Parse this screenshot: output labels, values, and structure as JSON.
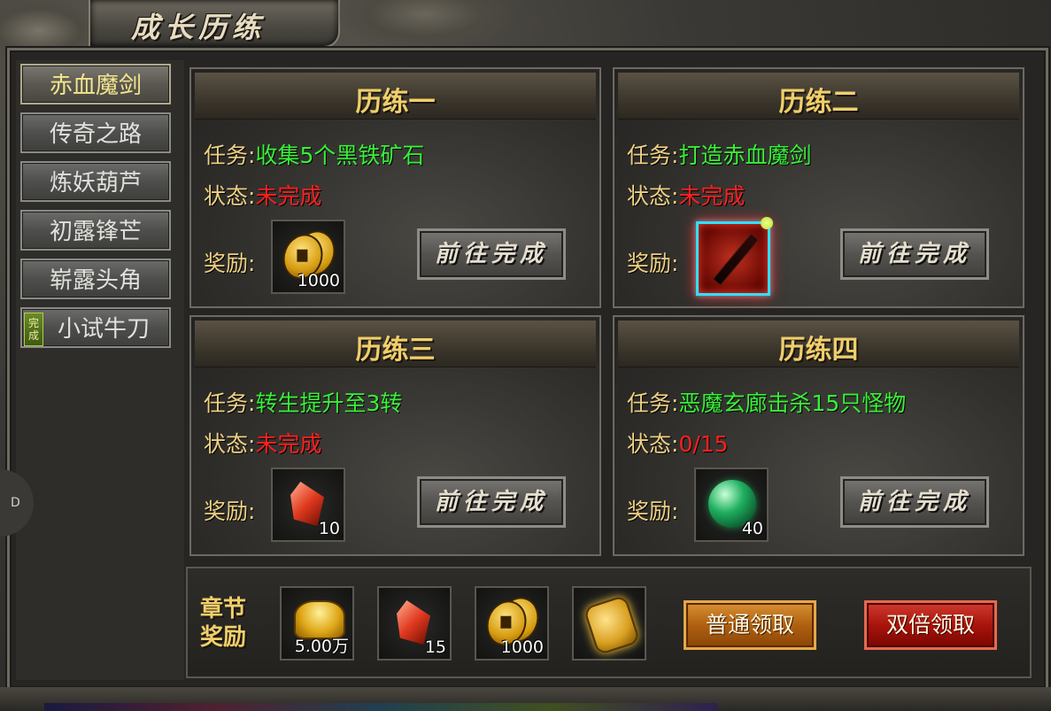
{
  "window": {
    "title": "成长历练"
  },
  "sidebar": {
    "tabs": [
      {
        "label": "赤血魔剑",
        "active": true
      },
      {
        "label": "传奇之路",
        "active": false
      },
      {
        "label": "炼妖葫芦",
        "active": false
      },
      {
        "label": "初露锋芒",
        "active": false
      },
      {
        "label": "崭露头角",
        "active": false
      },
      {
        "label": "小试牛刀",
        "active": false,
        "badge": "完成"
      }
    ]
  },
  "labels": {
    "task": "任务:",
    "status": "状态:",
    "reward": "奖励:"
  },
  "cards": [
    {
      "title": "历练一",
      "task": "收集5个黑铁矿石",
      "status": "未完成",
      "reward_icon": "gold-coin-icon",
      "reward_count": "1000",
      "button": "前往完成"
    },
    {
      "title": "历练二",
      "task": "打造赤血魔剑",
      "status": "未完成",
      "reward_icon": "crimson-sword-icon",
      "reward_count": "",
      "button": "前往完成"
    },
    {
      "title": "历练三",
      "task": "转生提升至3转",
      "status": "未完成",
      "reward_icon": "red-crystal-icon",
      "reward_count": "10",
      "button": "前往完成"
    },
    {
      "title": "历练四",
      "task": "恶魔玄廊击杀15只怪物",
      "status": "0/15",
      "reward_icon": "green-orb-icon",
      "reward_count": "40",
      "button": "前往完成"
    }
  ],
  "chapter": {
    "label_line1": "章节",
    "label_line2": "奖励",
    "rewards": [
      {
        "icon": "gold-ingot-icon",
        "count": "5.00万"
      },
      {
        "icon": "red-crystal-icon",
        "count": "15"
      },
      {
        "icon": "gold-coin-icon",
        "count": "1000"
      },
      {
        "icon": "gold-token-icon",
        "count": ""
      }
    ],
    "claim_button": "普通领取",
    "double_claim_button": "双倍领取"
  },
  "side_marker": "D",
  "colors": {
    "task_green": "#38f038",
    "status_red": "#ff2020",
    "title_gold": "#f0cf6a",
    "active_tab_text": "#f4e58c"
  }
}
